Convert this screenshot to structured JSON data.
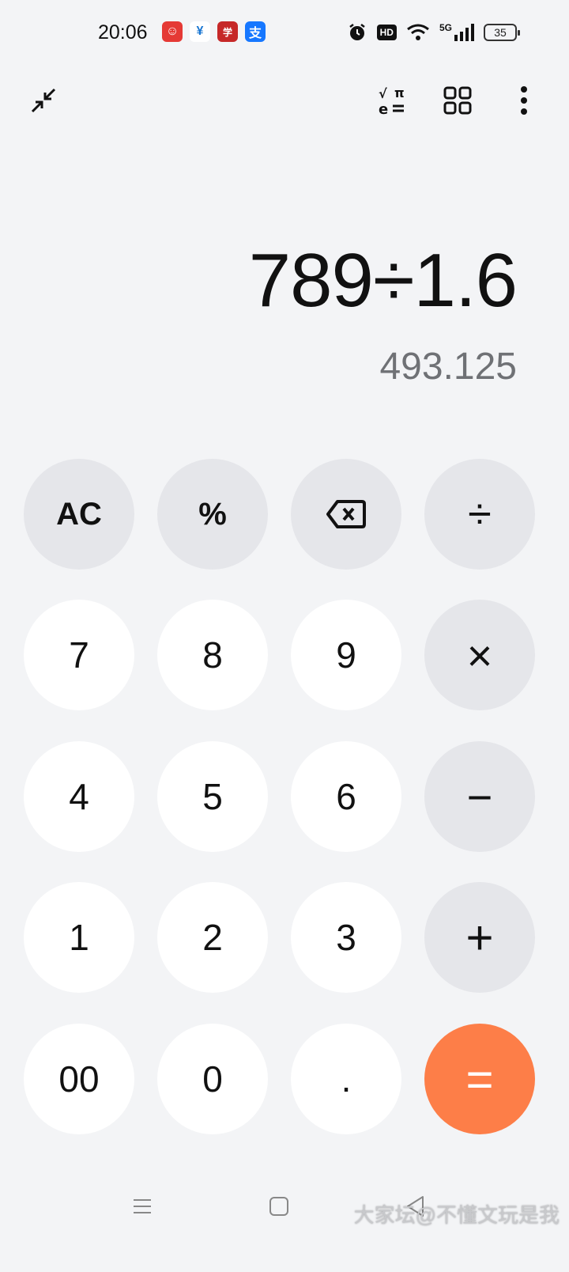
{
  "status_bar": {
    "time": "20:06",
    "hd_label": "HD",
    "network_label": "5G",
    "battery_level": "35",
    "notification_icons": [
      "jd-app-icon",
      "yang-app-icon",
      "red-app-icon",
      "alipay-icon"
    ],
    "notification_glyphs": [
      "☺",
      "¥",
      "学",
      "支"
    ]
  },
  "toolbar": {
    "collapse_icon": "collapse-icon",
    "scientific_icon": "scientific-mode-icon",
    "converter_icon": "grid-icon",
    "more_icon": "more-vert-icon"
  },
  "display": {
    "expression": "789÷1.6",
    "result": "493.125"
  },
  "keypad": {
    "rows": [
      [
        "AC",
        "%",
        "⌫",
        "÷"
      ],
      [
        "7",
        "8",
        "9",
        "×"
      ],
      [
        "4",
        "5",
        "6",
        "−"
      ],
      [
        "1",
        "2",
        "3",
        "+"
      ],
      [
        "00",
        "0",
        ".",
        "="
      ]
    ]
  },
  "nav_bar": {
    "menu_icon": "menu-icon",
    "home_icon": "home-square-icon",
    "back_icon": "back-triangle-icon"
  },
  "watermark": "大家坛@不懂文玩是我",
  "colors": {
    "background": "#f3f4f6",
    "number_key": "#ffffff",
    "function_key": "#e5e6ea",
    "equals_key": "#fd7e48",
    "result_text": "#6f7175"
  }
}
